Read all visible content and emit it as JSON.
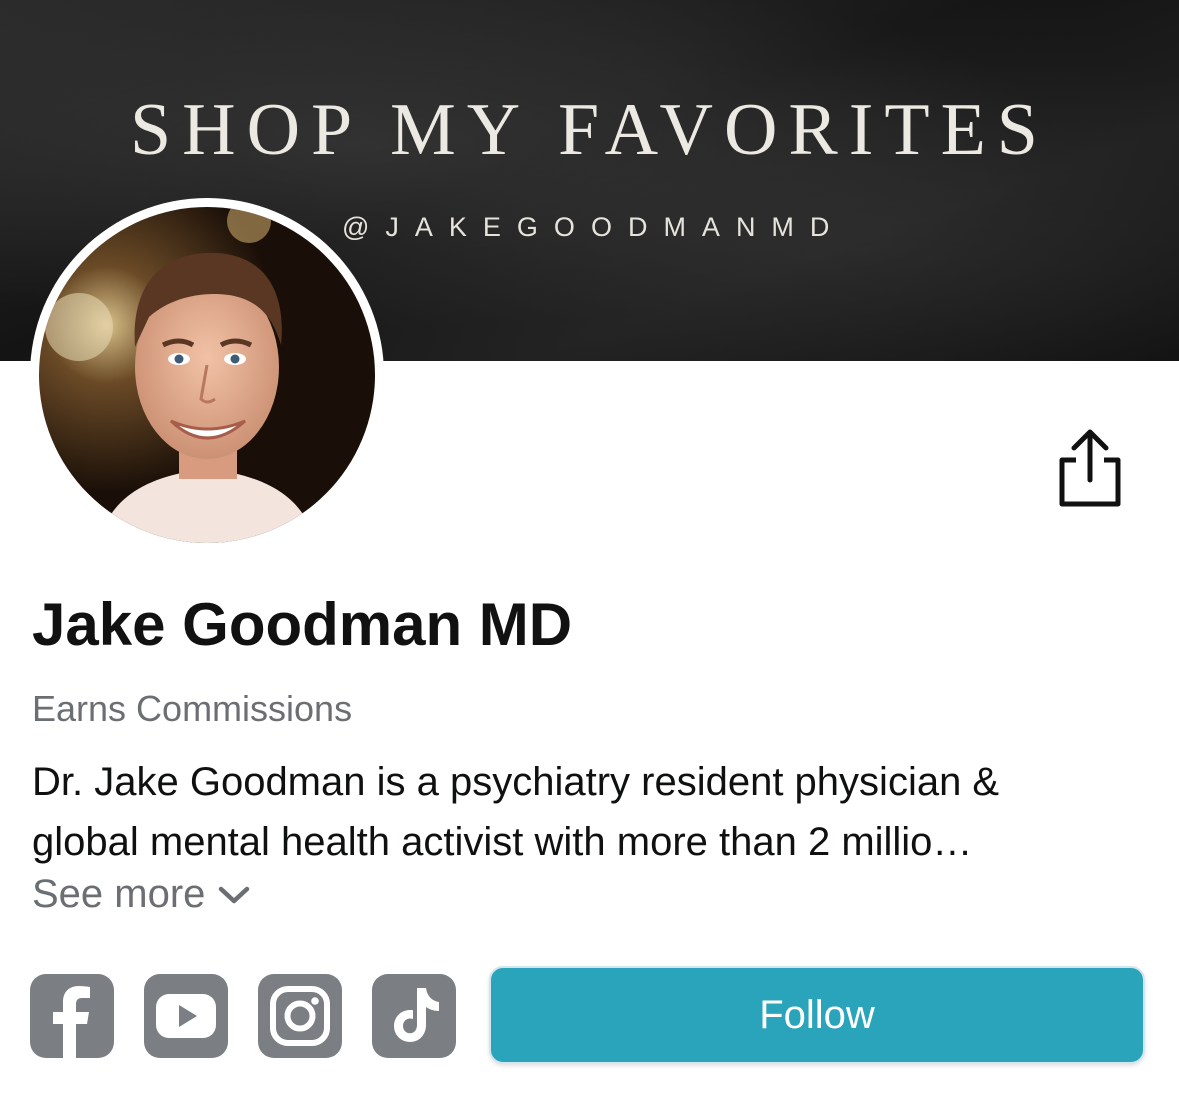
{
  "banner": {
    "title": "SHOP MY FAVORITES",
    "handle": "@JAKEGOODMANMD"
  },
  "profile": {
    "name": "Jake Goodman MD",
    "badge": "Earns Commissions",
    "bio_lines": [
      "Dr. Jake Goodman is a psychiatry resident physician &",
      "global mental health activist with more than 2 millio…"
    ],
    "see_more_label": "See more"
  },
  "actions": {
    "follow_label": "Follow"
  },
  "social_icons": [
    "facebook-icon",
    "youtube-icon",
    "instagram-icon",
    "tiktok-icon"
  ],
  "colors": {
    "accent": "#2aa4bb",
    "social_icon_bg": "#7b7f83",
    "muted_text": "#6b6f73"
  }
}
